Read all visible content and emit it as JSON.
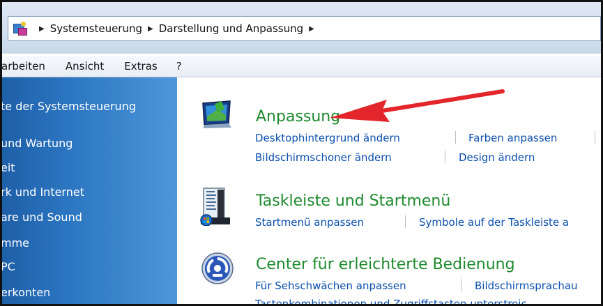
{
  "breadcrumb": {
    "items": [
      "Systemsteuerung",
      "Darstellung und Anpassung"
    ]
  },
  "menubar": {
    "items": [
      "arbeiten",
      "Ansicht",
      "Extras",
      "?"
    ]
  },
  "leftnav": {
    "items": [
      "te der Systemsteuerung",
      " und Wartung",
      "eit",
      "rk und Internet",
      "are und Sound",
      "mme",
      "PC",
      "erkonten"
    ]
  },
  "sections": {
    "anpassung": {
      "title": "Anpassung",
      "links": [
        "Desktophintergrund ändern",
        "Farben anpassen",
        "Bildschirmschoner ändern",
        "Design ändern"
      ]
    },
    "taskleiste": {
      "title": "Taskleiste und Startmenü",
      "links": [
        "Startmenü anpassen",
        "Symbole auf der Taskleiste a"
      ]
    },
    "access": {
      "title": "Center für erleichterte Bedienung",
      "links": [
        "Für Sehschwächen anpassen",
        "Bildschirmsprachau",
        "Tastenkombinationen und Zugriffstasten unterstreic"
      ]
    }
  },
  "colors": {
    "nav_blue": "#2d77c2",
    "link_blue": "#0a4fad",
    "title_green": "#1e8a2e",
    "arrow_red": "#e3262b"
  },
  "icons": [
    "control-panel-icon",
    "chevron-right-icon",
    "anpassung-icon",
    "taskbar-icon",
    "ease-of-access-icon",
    "red-arrow-annotation"
  ]
}
